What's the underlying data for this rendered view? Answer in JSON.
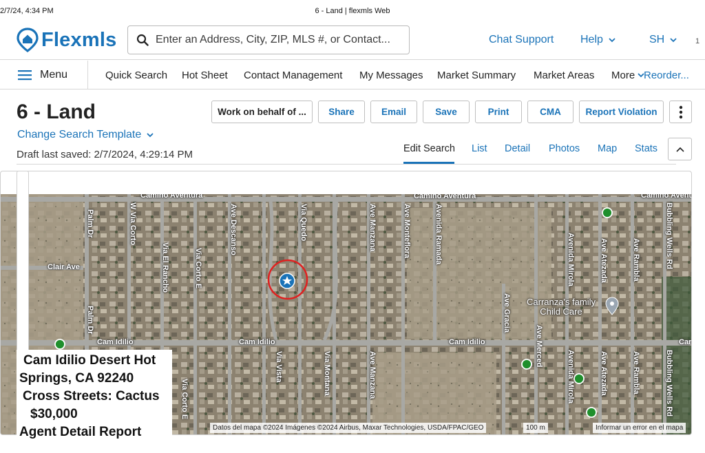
{
  "statusbar": {
    "time": "2/7/24, 4:34 PM",
    "title": "6 - Land | flexmls Web"
  },
  "header": {
    "logo_text": "Flexmls",
    "search_placeholder": "Enter an Address, City, ZIP, MLS #, or Contact...",
    "chat_support": "Chat Support",
    "help": "Help",
    "user_initials": "SH",
    "edge_digit": "1"
  },
  "nav": {
    "menu_label": "Menu",
    "items": [
      "Quick Search",
      "Hot Sheet",
      "Contact Management",
      "My Messages",
      "Market Summary",
      "Market Areas"
    ],
    "more": "More",
    "reorder": "Reorder..."
  },
  "page": {
    "title": "6 - Land",
    "change_template": "Change Search Template",
    "draft_saved": "Draft last saved: 2/7/2024, 4:29:14 PM"
  },
  "actions": {
    "work_on_behalf": "Work on behalf of ...",
    "share": "Share",
    "email": "Email",
    "save": "Save",
    "print": "Print",
    "cma": "CMA",
    "report_violation": "Report Violation"
  },
  "tabs": {
    "edit_search": "Edit Search",
    "list": "List",
    "detail": "Detail",
    "photos": "Photos",
    "map": "Map",
    "stats": "Stats"
  },
  "map": {
    "streets": {
      "camino_aventura_1": "Camino Aventura",
      "camino_aventura_2": "Camino Aventura",
      "camino_aventura_3": "Camino Aventu",
      "clair_ave": "Clair Ave",
      "cam_idilio_1": "Cam Idilio",
      "cam_idilio_2": "Cam Idilio",
      "cam_idilio_3": "Cam Idilio",
      "cam_idilio_4": "Car",
      "palm_dr_1": "Palm Dr",
      "palm_dr_2": "Palm Dr",
      "w_via_corto": "W Via Corto",
      "via_el_rancho": "Via El Rancho",
      "via_corto_e_1": "Via Corto E",
      "via_corto_e_2": "Via Corto E",
      "ave_descanso": "Ave Descanso",
      "via_quedo": "Via Quedo",
      "ave_manzana_1": "Ave Manzana",
      "ave_manzana_2": "Ave Manzana",
      "ave_monteflora": "Ave Monteflora",
      "avenida_ramada": "Avenida Ramada",
      "ave_gracia": "Ave Gracia",
      "avenida_mirola_1": "Avenida Mirola",
      "avenida_mirola_2": "Avenida Mirola",
      "ave_atezada_1": "Ave Atezada",
      "ave_atezada_2": "Ave Atezada",
      "ave_rambla_1": "Ave Rambla",
      "ave_rambla_2": "Ave Rambla",
      "bubbling_wells_1": "Bubbling Wells Rd",
      "bubbling_wells_2": "Bubbling Wells Rd",
      "ave_merced": "Ave Merced",
      "via_vista": "Via Vista",
      "via_montana": "Via Montana"
    },
    "poi": {
      "line1": "Carranza's family",
      "line2": "Child Care"
    },
    "attribution": "Datos del mapa ©2024 Imágenes ©2024 Airbus, Maxar Technologies, USDA/FPAC/GEO",
    "scale": "100 m",
    "report_error": "Informar un error en el mapa",
    "colors": {
      "pin": "#1a73b8",
      "ring": "#e02020",
      "listing_dot": "#1f8f2c"
    }
  },
  "info_card": {
    "line1": "Cam Idilio Desert Hot",
    "line2": "Springs, CA 92240",
    "line3": "Cross Streets: Cactus",
    "line4": "$30,000",
    "line5": "Agent Detail Report"
  }
}
